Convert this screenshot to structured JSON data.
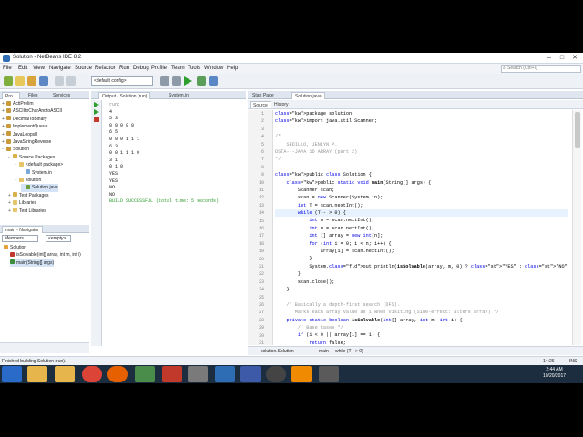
{
  "window": {
    "title": "Solution - NetBeans IDE 8.2"
  },
  "menu": [
    "File",
    "Edit",
    "View",
    "Navigate",
    "Source",
    "Refactor",
    "Run",
    "Debug",
    "Profile",
    "Team",
    "Tools",
    "Window",
    "Help"
  ],
  "search": {
    "placeholder": "Search (Ctrl+I)"
  },
  "toolbar": {
    "config": "<default config>"
  },
  "projects": {
    "tabs": [
      "Pro...",
      "Files",
      "Services"
    ],
    "tree": [
      {
        "label": "ActiPrelim",
        "indent": 0,
        "exp": "+"
      },
      {
        "label": "ASCIItoCharAndtoASCII",
        "indent": 0,
        "exp": "+"
      },
      {
        "label": "DecimalToBinary",
        "indent": 0,
        "exp": "+"
      },
      {
        "label": "ImplementQueue",
        "indent": 0,
        "exp": "+"
      },
      {
        "label": "JavaLoopsII",
        "indent": 0,
        "exp": "+"
      },
      {
        "label": "JavaStringReverse",
        "indent": 0,
        "exp": "+"
      },
      {
        "label": "Solution",
        "indent": 0,
        "exp": "-"
      },
      {
        "label": "Source Packages",
        "indent": 1,
        "exp": "-"
      },
      {
        "label": "<default package>",
        "indent": 2,
        "exp": "-"
      },
      {
        "label": "System.in",
        "indent": 3,
        "exp": ""
      },
      {
        "label": "solution",
        "indent": 2,
        "exp": "-"
      },
      {
        "label": "Solution.java",
        "indent": 3,
        "exp": ""
      },
      {
        "label": "Test Packages",
        "indent": 1,
        "exp": "+"
      },
      {
        "label": "Libraries",
        "indent": 1,
        "exp": "+"
      },
      {
        "label": "Test Libraries",
        "indent": 1,
        "exp": "+"
      }
    ]
  },
  "navigator": {
    "title": "main - Navigator",
    "filter": "Members",
    "filter2": "<empty>",
    "items": [
      {
        "label": "Solution",
        "indent": 0
      },
      {
        "label": "isSolvable(int[] array, int m, int i)",
        "indent": 1
      },
      {
        "label": "main(String[] args)",
        "indent": 1
      }
    ]
  },
  "output": {
    "tabs": [
      "Output - Solution (run)",
      "System.in"
    ],
    "lines": [
      "run:",
      "4",
      "5 3",
      "0 0 0 0 0",
      "6 5",
      "0 0 0 1 1 1",
      "6 3",
      "0 0 1 1 1 0",
      "3 1",
      "0 1 0",
      "YES",
      "YES",
      "NO",
      "NO",
      "BUILD SUCCESSFUL (total time: 5 seconds)"
    ]
  },
  "editor": {
    "tabs": [
      "Start Page",
      "Solution.java"
    ],
    "modes": [
      "Source",
      "History"
    ],
    "lines": [
      {
        "n": "1",
        "t": "package solution;"
      },
      {
        "n": "2",
        "t": "import java.util.Scanner;"
      },
      {
        "n": "3",
        "t": ""
      },
      {
        "n": "4",
        "t": "/*"
      },
      {
        "n": "5",
        "t": "    SEDILLO, JENLYN P."
      },
      {
        "n": "6",
        "t": "DSTA---JAVA 1D ARRAY (part 2)"
      },
      {
        "n": "7",
        "t": "*/"
      },
      {
        "n": "8",
        "t": ""
      },
      {
        "n": "9",
        "t": "public class Solution {"
      },
      {
        "n": "10",
        "t": "    public static void main(String[] args) {"
      },
      {
        "n": "11",
        "t": "        Scanner scan;"
      },
      {
        "n": "12",
        "t": "        scan = new Scanner(System.in);"
      },
      {
        "n": "13",
        "t": "        int T = scan.nextInt();"
      },
      {
        "n": "14",
        "t": "        while (T-- > 0) {"
      },
      {
        "n": "15",
        "t": "            int n = scan.nextInt();"
      },
      {
        "n": "16",
        "t": "            int m = scan.nextInt();"
      },
      {
        "n": "17",
        "t": "            int [] array = new int[n];"
      },
      {
        "n": "18",
        "t": "            for (int i = 0; i < n; i++) {"
      },
      {
        "n": "19",
        "t": "                array[i] = scan.nextInt();"
      },
      {
        "n": "20",
        "t": "            }"
      },
      {
        "n": "21",
        "t": "            System.out.println(isSolvable(array, m, 0) ? \"YES\" : \"NO\");"
      },
      {
        "n": "22",
        "t": "        }"
      },
      {
        "n": "23",
        "t": "        scan.close();"
      },
      {
        "n": "24",
        "t": "    }"
      },
      {
        "n": "25",
        "t": ""
      },
      {
        "n": "26",
        "t": "    /* Basically a depth-first search (DFS)."
      },
      {
        "n": "27",
        "t": "       Marks each array value as 1 when visiting (Side-effect: alters array) */"
      },
      {
        "n": "28",
        "t": "    private static boolean isSolvable(int[] array, int m, int i) {"
      },
      {
        "n": "29",
        "t": "        /* Base Cases */"
      },
      {
        "n": "30",
        "t": "        if (i < 0 || array[i] == 1) {"
      },
      {
        "n": "31",
        "t": "            return false;"
      }
    ],
    "highlight_line": 14,
    "breadcrumb": [
      "solution.Solution",
      "main",
      "while (T-- > 0)"
    ]
  },
  "status": {
    "left": "Finished building Solution (run).",
    "pos": "14:26",
    "mode": "INS"
  },
  "clock": {
    "time": "2:44 AM",
    "date": "10/20/2017"
  }
}
